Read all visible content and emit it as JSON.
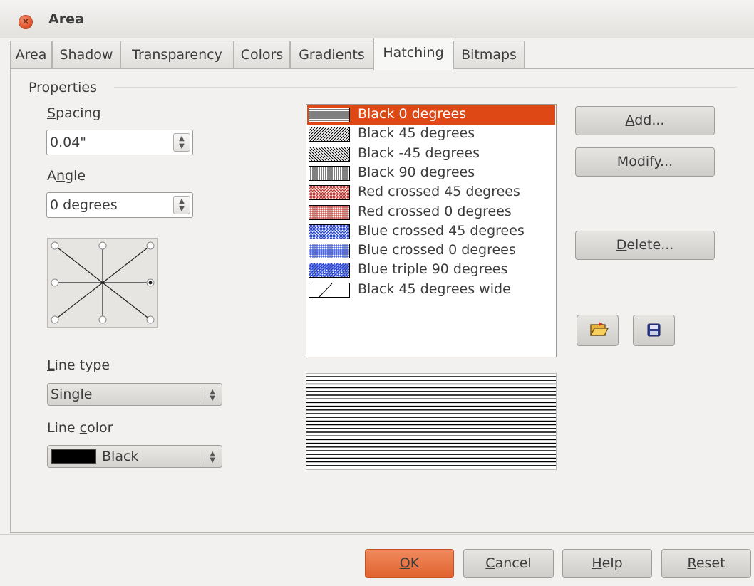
{
  "window": {
    "title": "Area"
  },
  "tabs": [
    "Area",
    "Shadow",
    "Transparency",
    "Colors",
    "Gradients",
    "Hatching",
    "Bitmaps"
  ],
  "active_tab": "Hatching",
  "properties": {
    "heading": "Properties",
    "spacing": {
      "label_u": "S",
      "label_rest": "pacing",
      "value": "0.04\""
    },
    "angle": {
      "label_a": "A",
      "label_u": "n",
      "label_rest": "gle",
      "value": "0 degrees",
      "selected_position": "right"
    },
    "line_type": {
      "label_u": "L",
      "label_rest": "ine type",
      "value": "Single"
    },
    "line_color": {
      "label_a": "Line ",
      "label_u": "c",
      "label_rest": "olor",
      "value": "Black",
      "swatch_color": "#000000"
    }
  },
  "hatch_list": {
    "selected_index": 0,
    "items": [
      {
        "name": "Black 0 degrees",
        "color": "#000000",
        "pattern": "horizontal"
      },
      {
        "name": "Black 45 degrees",
        "color": "#000000",
        "pattern": "diag45"
      },
      {
        "name": "Black -45 degrees",
        "color": "#000000",
        "pattern": "diag-45"
      },
      {
        "name": "Black 90 degrees",
        "color": "#000000",
        "pattern": "vertical"
      },
      {
        "name": "Red crossed 45 degrees",
        "color": "#c0312b",
        "pattern": "cross45"
      },
      {
        "name": "Red crossed 0 degrees",
        "color": "#c0312b",
        "pattern": "cross0"
      },
      {
        "name": "Blue crossed 45 degrees",
        "color": "#1f3fd0",
        "pattern": "cross45"
      },
      {
        "name": "Blue crossed 0 degrees",
        "color": "#1f3fd0",
        "pattern": "cross0"
      },
      {
        "name": "Blue triple 90 degrees",
        "color": "#1f3fd0",
        "pattern": "triple"
      },
      {
        "name": "Black 45 degrees wide",
        "color": "#000000",
        "pattern": "wide45"
      }
    ]
  },
  "buttons": {
    "add": {
      "u": "A",
      "rest": "dd..."
    },
    "modify": {
      "u": "M",
      "rest": "odify..."
    },
    "delete": {
      "u": "D",
      "rest": "elete..."
    },
    "ok": {
      "u": "O",
      "rest": "K"
    },
    "cancel": {
      "u": "C",
      "rest": "ancel"
    },
    "help": {
      "u": "H",
      "rest": "elp"
    },
    "reset": {
      "u": "R",
      "rest": "eset"
    }
  },
  "icons": {
    "load": "open-folder-icon",
    "save": "floppy-save-icon"
  },
  "colors": {
    "accent": "#dd4814",
    "ok_button": "#e8703f",
    "window_bg": "#f2f1f0"
  }
}
